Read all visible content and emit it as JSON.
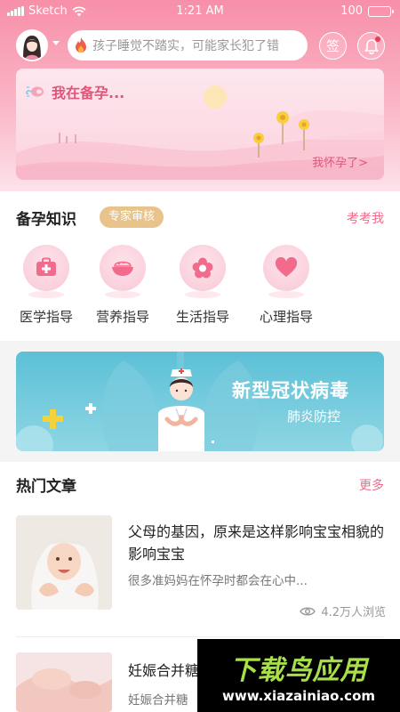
{
  "status_bar": {
    "carrier": "Sketch",
    "time": "1:21 AM",
    "battery": "100"
  },
  "header": {
    "search_placeholder": "孩子睡觉不踏实，可能家长犯了错",
    "sign_label": "签"
  },
  "banner": {
    "title": "我在备孕...",
    "link": "我怀孕了>"
  },
  "knowledge": {
    "title": "备孕知识",
    "badge": "专家审核",
    "link": "考考我",
    "items": [
      {
        "label": "医学指导",
        "icon": "medical-kit-icon"
      },
      {
        "label": "营养指导",
        "icon": "food-bowl-icon"
      },
      {
        "label": "生活指导",
        "icon": "flower-icon"
      },
      {
        "label": "心理指导",
        "icon": "heart-icon"
      }
    ]
  },
  "covid_banner": {
    "title": "新型冠状病毒",
    "subtitle": "肺炎防控"
  },
  "articles": {
    "title": "热门文章",
    "more": "更多",
    "items": [
      {
        "title": "父母的基因，原来是这样影响宝宝相貌的影响宝宝",
        "summary": "很多准妈妈在怀孕时都会在心中...",
        "views": "4.2万人浏览"
      },
      {
        "title": "妊娠合并糖",
        "summary": "妊娠合并糖"
      }
    ]
  },
  "watermark": {
    "title": "下载鸟应用",
    "url": "www.xiazainiao.com"
  },
  "colors": {
    "brand_pink": "#f78fa8",
    "accent_text": "#e0567a",
    "badge_gold": "#e8c48c",
    "watermark_green": "#a8e04a"
  }
}
